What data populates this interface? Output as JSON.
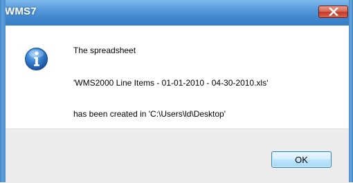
{
  "window": {
    "title": "WMS7",
    "close_icon": "close-icon"
  },
  "message": {
    "icon": "info-icon",
    "line1": "The spreadsheet",
    "line2": "'WMS2000 Line Items - 01-01-2010 - 04-30-2010.xls'",
    "line3": "has been created in 'C:\\Users\\ld\\Desktop'"
  },
  "buttons": {
    "ok_label": "OK"
  },
  "colors": {
    "title_bar": "#3f86cc",
    "close_button": "#c0392b",
    "footer": "#ececec",
    "ok_button_border": "#3c7fb1"
  }
}
